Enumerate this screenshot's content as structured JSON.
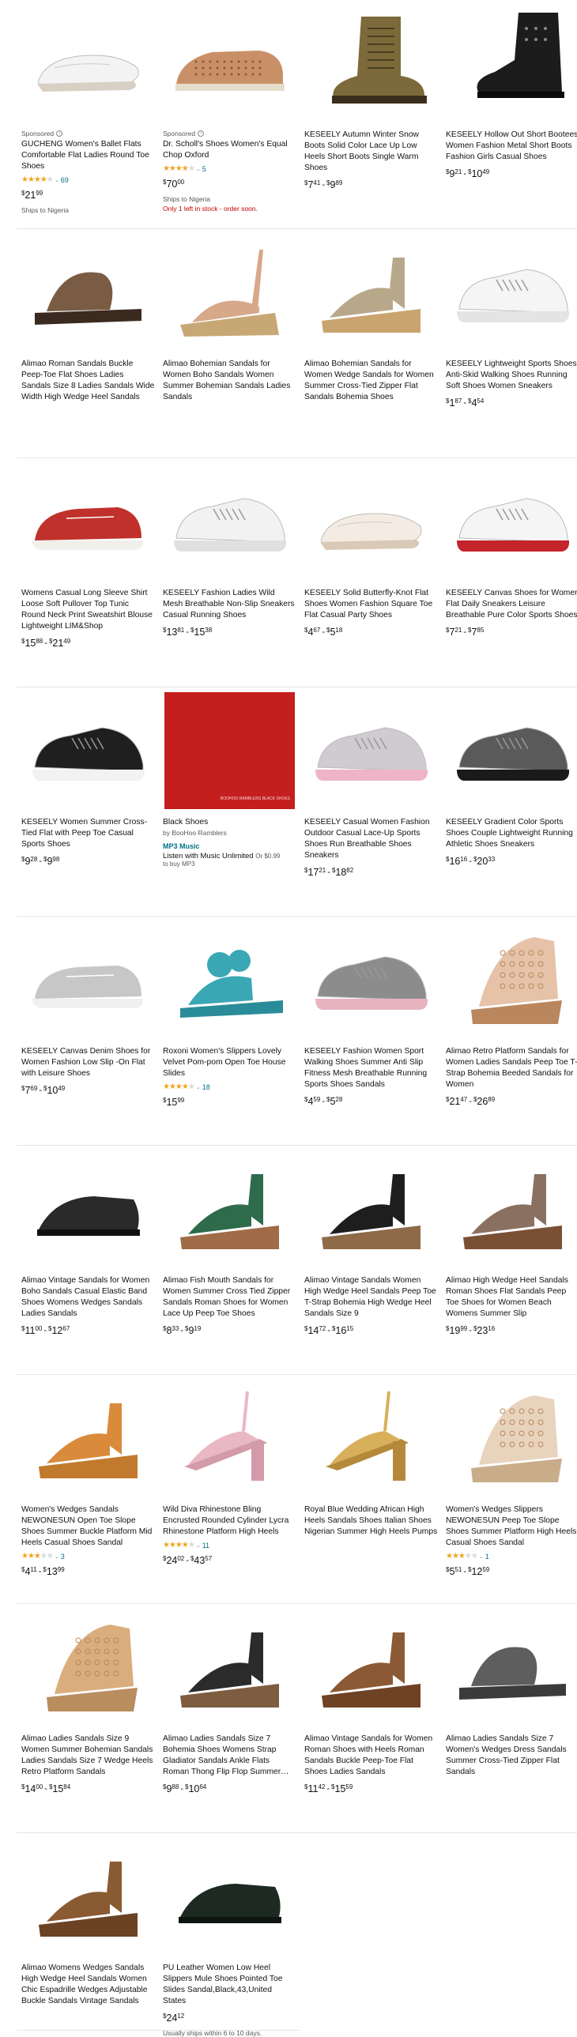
{
  "products": [
    {
      "sponsored": true,
      "sponsored_label": "Sponsored",
      "title": "GUCHENG Women's Ballet Flats Comfortable Flat Ladies Round Toe Shoes",
      "stars": 4,
      "reviews": "69",
      "price_parts": [
        {
          "d": "21",
          "c": "99"
        }
      ],
      "shipping": "Ships to Nigeria",
      "shoe": "flat",
      "color": "#f3f3f3",
      "sole": "#d8d0c4"
    },
    {
      "sponsored": true,
      "sponsored_label": "Sponsored",
      "title": "Dr. Scholl's Shoes Women's Equal Chop Oxford",
      "stars": 4,
      "reviews": "5",
      "price_parts": [
        {
          "d": "70",
          "c": "00"
        }
      ],
      "shipping": "Ships to Nigeria",
      "stock": "Only 1 left in stock - order soon.",
      "shoe": "oxford",
      "color": "#c99068",
      "sole": "#e6dccb"
    },
    {
      "title": "KESEELY Autumn Winter Snow Boots Solid Color Lace Up Low Heels Short Boots Single Warm Shoes",
      "price_parts": [
        {
          "d": "7",
          "c": "41"
        },
        {
          "d": "9",
          "c": "89"
        }
      ],
      "shoe": "boot",
      "color": "#7d6a3a",
      "sole": "#3a2f1d"
    },
    {
      "title": "KESEELY Hollow Out Short Bootees Women Fashion Metal Short Boots Fashion Girls Casual Shoes",
      "price_parts": [
        {
          "d": "9",
          "c": "21"
        },
        {
          "d": "10",
          "c": "49"
        }
      ],
      "shoe": "bootie",
      "color": "#1c1c1c",
      "sole": "#0a0a0a"
    },
    {
      "title": "Alimao Roman Sandals Buckle Peep-Toe Flat Shoes Ladies Sandals Size 8 Ladies Sandals Wide Width High Wedge Heel Sandals",
      "shoe": "slide",
      "color": "#7a5c44",
      "sole": "#3b2a1f"
    },
    {
      "title": "Alimao Bohemian Sandals for Women Boho Sandals Women Summer Bohemian Sandals Ladies Sandals",
      "shoe": "espadrille",
      "color": "#d8a88a",
      "sole": "#c7a875"
    },
    {
      "title": "Alimao Bohemian Sandals for Women Wedge Sandals for Women Summer Cross-Tied Zipper Flat Sandals Bohemia Shoes",
      "shoe": "wedge",
      "color": "#b8a88a",
      "sole": "#c9a46e"
    },
    {
      "title": "KESEELY Lightweight Sports Shoes Anti-Skid Walking Shoes Running Soft Shoes Women Sneakers",
      "price_parts": [
        {
          "d": "1",
          "c": "87"
        },
        {
          "d": "4",
          "c": "54"
        }
      ],
      "shoe": "sneaker",
      "color": "#f5f5f5",
      "sole": "#e4e4e4"
    },
    {
      "title": "Womens Casual Long Sleeve Shirt Loose Soft Pullover Top Tunic Round Neck Print Sweatshirt Blouse Lightweight LIM&Shop",
      "price_parts": [
        {
          "d": "15",
          "c": "88"
        },
        {
          "d": "21",
          "c": "49"
        }
      ],
      "shoe": "loafer",
      "color": "#c0312b",
      "sole": "#f1efe9"
    },
    {
      "title": "KESEELY Fashion Ladies Wild Mesh Breathable Non-Slip Sneakers Casual Running Shoes",
      "price_parts": [
        {
          "d": "13",
          "c": "81"
        },
        {
          "d": "15",
          "c": "38"
        }
      ],
      "shoe": "sneaker",
      "color": "#f2f2f2",
      "sole": "#e0e0e0"
    },
    {
      "title": "KESEELY Solid Butterfly-Knot Flat Shoes Women Fashion Square Toe Flat Casual Party Shoes",
      "price_parts": [
        {
          "d": "4",
          "c": "67"
        },
        {
          "d": "5",
          "c": "18"
        }
      ],
      "shoe": "flat",
      "color": "#f4ece3",
      "sole": "#d9c9b6"
    },
    {
      "title": "KESEELY Canvas Shoes for Women Flat Daily Sneakers Leisure Breathable Pure Color Sports Shoes",
      "price_parts": [
        {
          "d": "7",
          "c": "21"
        },
        {
          "d": "7",
          "c": "85"
        }
      ],
      "shoe": "sneaker",
      "color": "#f5f5f5",
      "sole": "#c4242b"
    },
    {
      "title": "KESEELY Women Summer Cross-Tied Flat with Peep Toe Casual Sports Shoes",
      "price_parts": [
        {
          "d": "9",
          "c": "28"
        },
        {
          "d": "9",
          "c": "98"
        }
      ],
      "shoe": "sneaker",
      "color": "#1f1f1f",
      "sole": "#f2f2f2"
    },
    {
      "title": "Black Shoes",
      "byline": "by BooHoo Ramblers",
      "format": "MP3 Music",
      "music_line": "Listen with Music Unlimited",
      "music_or": "Or $0.99",
      "buy_mp3": "to buy MP3",
      "book": true,
      "book_text": "BOOHOO RAMBLERS\nBLACK SHOES"
    },
    {
      "title": "KESEELY Casual Women Fashion Outdoor Casual Lace-Up Sports Shoes Run Breathable Shoes Sneakers",
      "price_parts": [
        {
          "d": "17",
          "c": "21"
        },
        {
          "d": "18",
          "c": "82"
        }
      ],
      "shoe": "sneaker",
      "color": "#cfcbd1",
      "sole": "#efb4c8"
    },
    {
      "title": "KESEELY Gradient Color Sports Shoes Couple Lightweight Running Athletic Shoes Sneakers",
      "price_parts": [
        {
          "d": "16",
          "c": "16"
        },
        {
          "d": "20",
          "c": "33"
        }
      ],
      "shoe": "sneaker",
      "color": "#5a5a5a",
      "sole": "#1a1a1a"
    },
    {
      "title": "KESEELY Canvas Denim Shoes for Women Fashion Low Slip -On Flat with Leisure Shoes",
      "price_parts": [
        {
          "d": "7",
          "c": "69"
        },
        {
          "d": "10",
          "c": "49"
        }
      ],
      "shoe": "loafer",
      "color": "#c7c7c7",
      "sole": "#f0f0f0"
    },
    {
      "title": "Roxoni Women's Slippers Lovely Velvet Pom-pom Open Toe House Slides",
      "stars": 4,
      "reviews": "18",
      "price_parts": [
        {
          "d": "15",
          "c": "99"
        }
      ],
      "shoe": "slipper",
      "color": "#3aa7b5",
      "sole": "#2a8c98"
    },
    {
      "title": "KESEELY Fashion Women Sport Walking Shoes Summer Anti Slip Fitness Mesh Breathable Running Sports Shoes Sandals",
      "price_parts": [
        {
          "d": "4",
          "c": "59"
        },
        {
          "d": "5",
          "c": "28"
        }
      ],
      "shoe": "sneaker",
      "color": "#8c8c8c",
      "sole": "#e8b4bf"
    },
    {
      "title": "Alimao Retro Platform Sandals for Women Ladies Sandals Peep Toe T-Strap Bohemia Beeded Sandals for Women",
      "price_parts": [
        {
          "d": "21",
          "c": "47"
        },
        {
          "d": "26",
          "c": "89"
        }
      ],
      "shoe": "wedgeboot",
      "color": "#e6c3a8",
      "sole": "#b9865d"
    },
    {
      "title": "Alimao Vintage Sandals for Women Boho Sandals Casual Elastic Band Shoes Womens Wedges Sandals Ladies Sandals",
      "price_parts": [
        {
          "d": "11",
          "c": "00"
        },
        {
          "d": "12",
          "c": "67"
        }
      ],
      "shoe": "mule",
      "color": "#2a2a2a",
      "sole": "#111"
    },
    {
      "title": "Alimao Fish Mouth Sandals for Women Summer Cross Tied Zipper Sandals Roman Shoes for Women Lace Up Peep Toe Shoes",
      "price_parts": [
        {
          "d": "8",
          "c": "33"
        },
        {
          "d": "9",
          "c": "19"
        }
      ],
      "shoe": "wedge",
      "color": "#2e6b4a",
      "sole": "#a06b47"
    },
    {
      "title": "Alimao Vintage Sandals Women High Wedge Heel Sandals Peep Toe T-Strap Bohemia High Wedge Heel Sandals Size 9",
      "price_parts": [
        {
          "d": "14",
          "c": "72"
        },
        {
          "d": "16",
          "c": "15"
        }
      ],
      "shoe": "wedge",
      "color": "#1e1e1e",
      "sole": "#8e6a48"
    },
    {
      "title": "Alimao High Wedge Heel Sandals Roman Shoes Flat Sandals Peep Toe Shoes for Women Beach Womens Summer Slip",
      "price_parts": [
        {
          "d": "19",
          "c": "99"
        },
        {
          "d": "23",
          "c": "16"
        }
      ],
      "shoe": "wedge",
      "color": "#8a7060",
      "sole": "#7a5035"
    },
    {
      "title": "Women's Wedges Sandals NEWONESUN Open Toe Slope Shoes Summer Buckle Platform Mid Heels Casual Shoes Sandal",
      "stars": 3,
      "reviews": "3",
      "price_parts": [
        {
          "d": "4",
          "c": "11"
        },
        {
          "d": "13",
          "c": "99"
        }
      ],
      "shoe": "wedge",
      "color": "#d98a3a",
      "sole": "#c17a2d"
    },
    {
      "title": "Wild Diva Rhinestone Bling Encrusted Rounded Cylinder Lycra Rhinestone Platform High Heels",
      "stars": 4,
      "reviews": "11",
      "price_parts": [
        {
          "d": "24",
          "c": "02"
        },
        {
          "d": "43",
          "c": "57"
        }
      ],
      "shoe": "heel",
      "color": "#e8b8c4",
      "sole": "#d39aaa"
    },
    {
      "title": "Royal Blue Wedding African High Heels Sandals Shoes Italian Shoes Nigerian Summer High Heels Pumps",
      "price_parts": [],
      "shoe": "heel",
      "color": "#d8b05c",
      "sole": "#b48a3a"
    },
    {
      "title": "Women's Wedges Slippers NEWONESUN Peep Toe Slope Shoes Summer Platform High Heels Casual Shoes Sandal",
      "stars": 3,
      "reviews": "1",
      "price_parts": [
        {
          "d": "5",
          "c": "51"
        },
        {
          "d": "12",
          "c": "59"
        }
      ],
      "shoe": "wedgeboot",
      "color": "#e8d4bd",
      "sole": "#c9ad8b"
    },
    {
      "title": "Alimao Ladies Sandals Size 9 Women Summer Bohemian Sandals Ladies Sandals Size 7 Wedge Heels Retro Platform Sandals",
      "price_parts": [
        {
          "d": "14",
          "c": "00"
        },
        {
          "d": "15",
          "c": "84"
        }
      ],
      "shoe": "wedgeboot",
      "color": "#d9ae7c",
      "sole": "#b98d5e"
    },
    {
      "title": "Alimao Ladies Sandals Size 7 Bohemia Shoes Womens Strap Gladiator Sandals Ankle Flats Roman Thong Flip Flop Summer…",
      "price_parts": [
        {
          "d": "9",
          "c": "88"
        },
        {
          "d": "10",
          "c": "64"
        }
      ],
      "shoe": "wedge",
      "color": "#2b2b2b",
      "sole": "#7d5c3f"
    },
    {
      "title": "Alimao Vintage Sandals for Women Roman Shoes with Heels Roman Sandals Buckle Peep-Toe Flat Shoes Ladies Sandals",
      "price_parts": [
        {
          "d": "11",
          "c": "42"
        },
        {
          "d": "15",
          "c": "59"
        }
      ],
      "shoe": "wedge",
      "color": "#8b5a35",
      "sole": "#6d4225"
    },
    {
      "title": "Alimao Ladies Sandals Size 7 Women's Wedges Dress Sandals Summer Cross-Tied Zipper Flat Sandals",
      "shoe": "slide",
      "color": "#5e5e5e",
      "sole": "#3b3b3b"
    },
    {
      "title": "Alimao Womens Wedges Sandals High Wedge Heel Sandals Women Chic Espadrille Wedges Adjustable Buckle Sandals Vintage Sandals",
      "shoe": "wedge",
      "color": "#8a5a32",
      "sole": "#6b4224"
    },
    {
      "title": "PU Leather Women Low Heel Slippers Mule Shoes Pointed Toe Slides Sandal,Black,43,United States",
      "price_parts": [
        {
          "d": "24",
          "c": "12"
        }
      ],
      "shipping": "Usually ships within 6 to 10 days.",
      "shoe": "mule",
      "color": "#1c2a22",
      "sole": "#0e1410"
    }
  ]
}
